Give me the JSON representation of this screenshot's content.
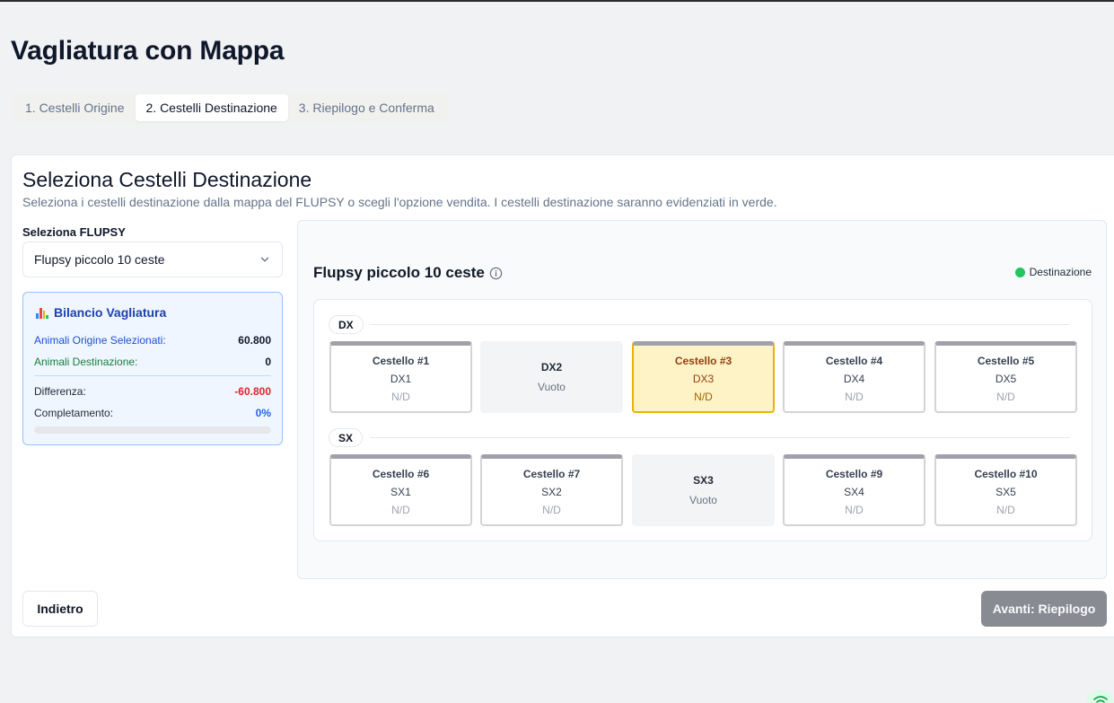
{
  "page": {
    "title": "Vagliatura con Mappa"
  },
  "tabs": [
    {
      "label": "1. Cestelli Origine",
      "active": false
    },
    {
      "label": "2. Cestelli Destinazione",
      "active": true
    },
    {
      "label": "3. Riepilogo e Conferma",
      "active": false
    }
  ],
  "card": {
    "title": "Seleziona Cestelli Destinazione",
    "description": "Seleziona i cestelli destinazione dalla mappa del FLUPSY o scegli l'opzione vendita. I cestelli destinazione saranno evidenziati in verde."
  },
  "flupsy_select": {
    "label": "Seleziona FLUPSY",
    "value": "Flupsy piccolo 10 ceste",
    "icon": "chevron-down-icon"
  },
  "balance": {
    "title": "Bilancio Vagliatura",
    "icon": "bar-chart-icon",
    "rows": [
      {
        "label": "Animali Origine Selezionati:",
        "value": "60.800"
      },
      {
        "label": "Animali Destinazione:",
        "value": "0"
      },
      {
        "label": "Differenza:",
        "value": "-60.800"
      },
      {
        "label": "Completamento:",
        "value": "0%"
      }
    ],
    "progress_fraction": 0,
    "colors": {
      "origin_label": "#1d4ed8",
      "dest_label": "#15803d",
      "negative": "#dc2626",
      "percent": "#2563eb"
    }
  },
  "map": {
    "title": "Flupsy piccolo 10 ceste",
    "info_icon": "info-icon",
    "legend": {
      "label": "Destinazione",
      "color": "#22c55e"
    },
    "rows": [
      {
        "label": "DX",
        "baskets": [
          {
            "name": "Cestello #1",
            "position": "DX1",
            "status": "N/D",
            "state": "filled"
          },
          {
            "name": "",
            "position": "DX2",
            "status": "Vuoto",
            "state": "empty"
          },
          {
            "name": "Cestello #3",
            "position": "DX3",
            "status": "N/D",
            "state": "selected"
          },
          {
            "name": "Cestello #4",
            "position": "DX4",
            "status": "N/D",
            "state": "filled"
          },
          {
            "name": "Cestello #5",
            "position": "DX5",
            "status": "N/D",
            "state": "filled"
          }
        ]
      },
      {
        "label": "SX",
        "baskets": [
          {
            "name": "Cestello #6",
            "position": "SX1",
            "status": "N/D",
            "state": "filled"
          },
          {
            "name": "Cestello #7",
            "position": "SX2",
            "status": "N/D",
            "state": "filled"
          },
          {
            "name": "",
            "position": "SX3",
            "status": "Vuoto",
            "state": "empty"
          },
          {
            "name": "Cestello #9",
            "position": "SX4",
            "status": "N/D",
            "state": "filled"
          },
          {
            "name": "Cestello #10",
            "position": "SX5",
            "status": "N/D",
            "state": "filled"
          }
        ]
      }
    ]
  },
  "actions": {
    "back_label": "Indietro",
    "next_label": "Avanti: Riepilogo"
  },
  "status_icon": "wifi-icon"
}
